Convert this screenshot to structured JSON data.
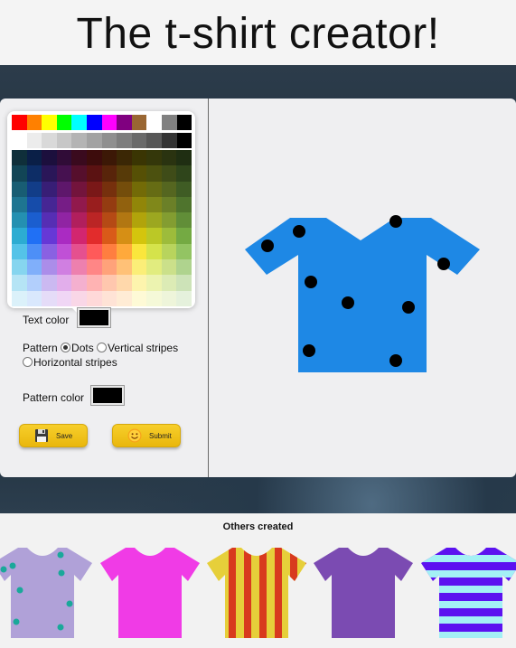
{
  "header": {
    "title": "The t-shirt creator!"
  },
  "palette": {
    "top_row": [
      "#ff0000",
      "#ff8000",
      "#ffff00",
      "#00ff00",
      "#00ffff",
      "#0000ff",
      "#ff00ff",
      "#800080",
      "#996633",
      "#ffffff",
      "#808080",
      "#000000"
    ],
    "gray_row": [
      "#ffffff",
      "#ececec",
      "#d9d9d9",
      "#c7c7c7",
      "#b4b4b4",
      "#a2a2a2",
      "#8f8f8f",
      "#7d7d7d",
      "#6a6a6a",
      "#575757",
      "#333333",
      "#000000"
    ],
    "grid_rows": [
      [
        "#0f2f3a",
        "#0a1f47",
        "#1c0f3d",
        "#300c37",
        "#3a0a1e",
        "#3d0c0c",
        "#3c1806",
        "#3b2705",
        "#3a3503",
        "#34370a",
        "#2a3310",
        "#1f2e12"
      ],
      [
        "#124556",
        "#0d2d66",
        "#2a1658",
        "#461150",
        "#560f2c",
        "#5b1212",
        "#58240a",
        "#573a08",
        "#565005",
        "#4c510f",
        "#3f4c18",
        "#2f451b"
      ],
      [
        "#185d73",
        "#123d88",
        "#381e76",
        "#5e176b",
        "#73143c",
        "#7a1818",
        "#76300d",
        "#744d0b",
        "#736b07",
        "#666c14",
        "#556620",
        "#3f5c24"
      ],
      [
        "#1e7591",
        "#164caa",
        "#462694",
        "#761d86",
        "#91194c",
        "#991e1e",
        "#943c11",
        "#91610e",
        "#918609",
        "#80881a",
        "#6b8028",
        "#4f742d"
      ],
      [
        "#2490b1",
        "#1b5ecf",
        "#562eb4",
        "#9024a3",
        "#b11f5d",
        "#bb2525",
        "#b54a15",
        "#b27712",
        "#b1a40b",
        "#9ca720",
        "#839d31",
        "#618e38"
      ],
      [
        "#2cacd2",
        "#2070f5",
        "#6638d6",
        "#aa2bc2",
        "#d2266f",
        "#e22c2c",
        "#d95a19",
        "#d68f15",
        "#d4c50d",
        "#bbc826",
        "#9dbc3b",
        "#74aa43"
      ],
      [
        "#54c3e8",
        "#4d8ff7",
        "#8a61e2",
        "#c050d6",
        "#e5508f",
        "#ff5a5a",
        "#ff7e40",
        "#ffa93b",
        "#fae63c",
        "#d5e34b",
        "#b8d45d",
        "#93c463"
      ],
      [
        "#86d5ef",
        "#80affa",
        "#ab8de9",
        "#d07fe1",
        "#ed80ae",
        "#ff8686",
        "#ffa27a",
        "#ffc177",
        "#fbee78",
        "#e1ec7f",
        "#cbe08a",
        "#afd38e"
      ],
      [
        "#b5e4f5",
        "#b2cffc",
        "#cbb9f1",
        "#e2aeeb",
        "#f4b0cf",
        "#ffb3b3",
        "#ffc7ae",
        "#ffd8ab",
        "#fdf4ad",
        "#ecf3b0",
        "#dcebb5",
        "#cde3b8"
      ],
      [
        "#dbf1fa",
        "#d9e8fd",
        "#e5dcf8",
        "#f0d6f5",
        "#f9d7e7",
        "#ffd9d9",
        "#ffe3d6",
        "#ffecd5",
        "#fefad6",
        "#f5f9d8",
        "#eef5da",
        "#e5f1dc"
      ]
    ]
  },
  "controls": {
    "text_color_label": "Text color",
    "text_color_value": "#000000",
    "pattern_label": "Pattern",
    "pattern_options": [
      "Dots",
      "Vertical stripes",
      "Horizontal stripes"
    ],
    "pattern_selected": "Dots",
    "pattern_color_label": "Pattern color",
    "pattern_color_value": "#000000",
    "save_label": "Save",
    "submit_label": "Submit",
    "save_icon": "floppy-disk-icon",
    "submit_icon": "smiley-icon"
  },
  "preview": {
    "shirt_color": "#1e88e5",
    "pattern": "dots",
    "pattern_color": "#000000"
  },
  "others": {
    "title": "Others created",
    "shirts": [
      {
        "color": "#b0a1d8",
        "pattern": "dots",
        "pattern_color": "#1aa89a"
      },
      {
        "color": "#f03be6",
        "pattern": "none"
      },
      {
        "color": "#e6cf3a",
        "pattern": "vertical stripes",
        "pattern_color": "#d83a1e"
      },
      {
        "color": "#7b4bb2",
        "pattern": "none"
      },
      {
        "color": "#5c12f0",
        "pattern": "horizontal stripes",
        "pattern_color": "#a3f0f5"
      }
    ]
  }
}
